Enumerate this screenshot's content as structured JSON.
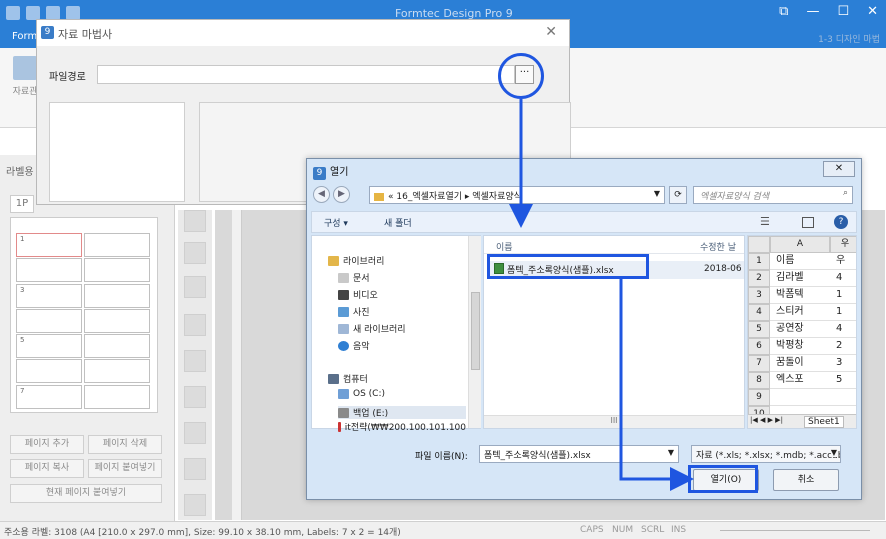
{
  "app": {
    "title": "Formtec Design Pro 9",
    "tab_label": "Form",
    "ribbon_right": "1-3 디자인 마법",
    "ribbon_button": "자료관",
    "left_panel_title": "라벨용",
    "page_tab": "1P",
    "label_cells": [
      "1",
      "",
      "",
      "",
      "3",
      "",
      "",
      "",
      "5",
      "",
      "",
      "",
      "7",
      ""
    ],
    "buttons": {
      "add_page": "페이지 추가",
      "delete_page": "페이지 삭제",
      "copy_page": "페이지 복사",
      "paste_page": "페이지 붙여넣기",
      "paste_current": "현재 페이지 붙여넣기"
    },
    "status": {
      "text": "주소용 라벨: 3108 (A4 [210.0 x 297.0 mm], Size: 99.10 x 38.10 mm, Labels: 7 x 2 = 14개)",
      "caps": "CAPS",
      "num": "NUM",
      "scrl": "SCRL",
      "ins": "INS"
    }
  },
  "wizard": {
    "title": "자료 마법사",
    "path_label": "파일경로",
    "path_value": "",
    "browse_label": "···"
  },
  "open_dialog": {
    "title": "열기",
    "address_path": "« 16_엑셀자료열기 ▸ 엑셀자료양식",
    "search_placeholder": "엑셀자료양식 검색",
    "toolbar": {
      "organize": "구성 ▾",
      "new_folder": "새 폴더"
    },
    "nav": {
      "library": "라이브러리",
      "documents": "문서",
      "videos": "비디오",
      "pictures": "사진",
      "new_library": "새 라이브러리",
      "music": "음악",
      "computer": "컴퓨터",
      "drive_c": "OS (C:)",
      "drive_e": "백업 (E:)",
      "network": "it전략(₩₩200.100.101.100"
    },
    "columns": {
      "name": "이름",
      "modified": "수정한 날"
    },
    "files": [
      {
        "name": "폼텍_주소록양식(샘플).xlsx",
        "date": "2018-06"
      }
    ],
    "preview": {
      "col_headers": [
        "A",
        "우"
      ],
      "rows": [
        {
          "n": "1",
          "a": "이름",
          "b": "우"
        },
        {
          "n": "2",
          "a": "김라벨",
          "b": "4"
        },
        {
          "n": "3",
          "a": "박폼텍",
          "b": "1"
        },
        {
          "n": "4",
          "a": "스티커",
          "b": "1"
        },
        {
          "n": "5",
          "a": "공연장",
          "b": "4"
        },
        {
          "n": "6",
          "a": "박평창",
          "b": "2"
        },
        {
          "n": "7",
          "a": "꿈돌이",
          "b": "3"
        },
        {
          "n": "8",
          "a": "엑스포",
          "b": "5"
        },
        {
          "n": "9",
          "a": "",
          "b": ""
        },
        {
          "n": "10",
          "a": "",
          "b": ""
        },
        {
          "n": "11",
          "a": "",
          "b": ""
        }
      ],
      "sheet": "Sheet1"
    },
    "filename_label": "파일 이름(N):",
    "filename_value": "폼텍_주소록양식(샘플).xlsx",
    "filetype_value": "자료 (*.xls; *.xlsx; *.mdb; *.accdb)",
    "open_label": "열기(O)",
    "cancel_label": "취소"
  },
  "colors": {
    "accent": "#1f56e0",
    "title_blue": "#2b7fd6"
  }
}
